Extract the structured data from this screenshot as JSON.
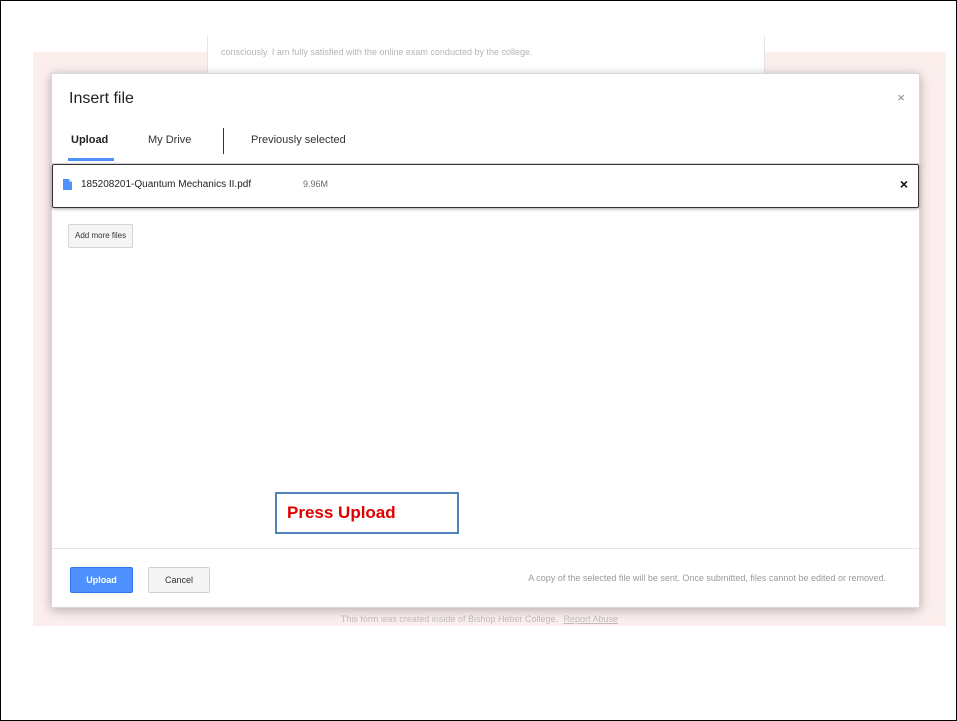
{
  "background": {
    "partial_text": "consciously. I am fully satisfied with the online exam conducted by the college.",
    "footer_text": "This form was created inside of Bishop Heber College.",
    "footer_link": "Report Abuse"
  },
  "dialog": {
    "title": "Insert file",
    "close_icon": "×",
    "tabs": [
      {
        "label": "Upload"
      },
      {
        "label": "My Drive"
      },
      {
        "label": "Previously selected"
      }
    ],
    "file": {
      "name": "185208201-Quantum Mechanics II.pdf",
      "size": "9.96M",
      "remove_icon": "×",
      "icon": "document-icon"
    },
    "add_more_label": "Add more files",
    "upload_label": "Upload",
    "cancel_label": "Cancel",
    "footer_note": "A copy of the selected file will be sent. Once submitted, files cannot be edited or removed."
  },
  "annotation": {
    "text": "Press Upload"
  },
  "colors": {
    "accent": "#4d90fe",
    "annotation_border": "#4f81bd",
    "annotation_text": "#e00000",
    "page_bg": "#fbeeed"
  }
}
